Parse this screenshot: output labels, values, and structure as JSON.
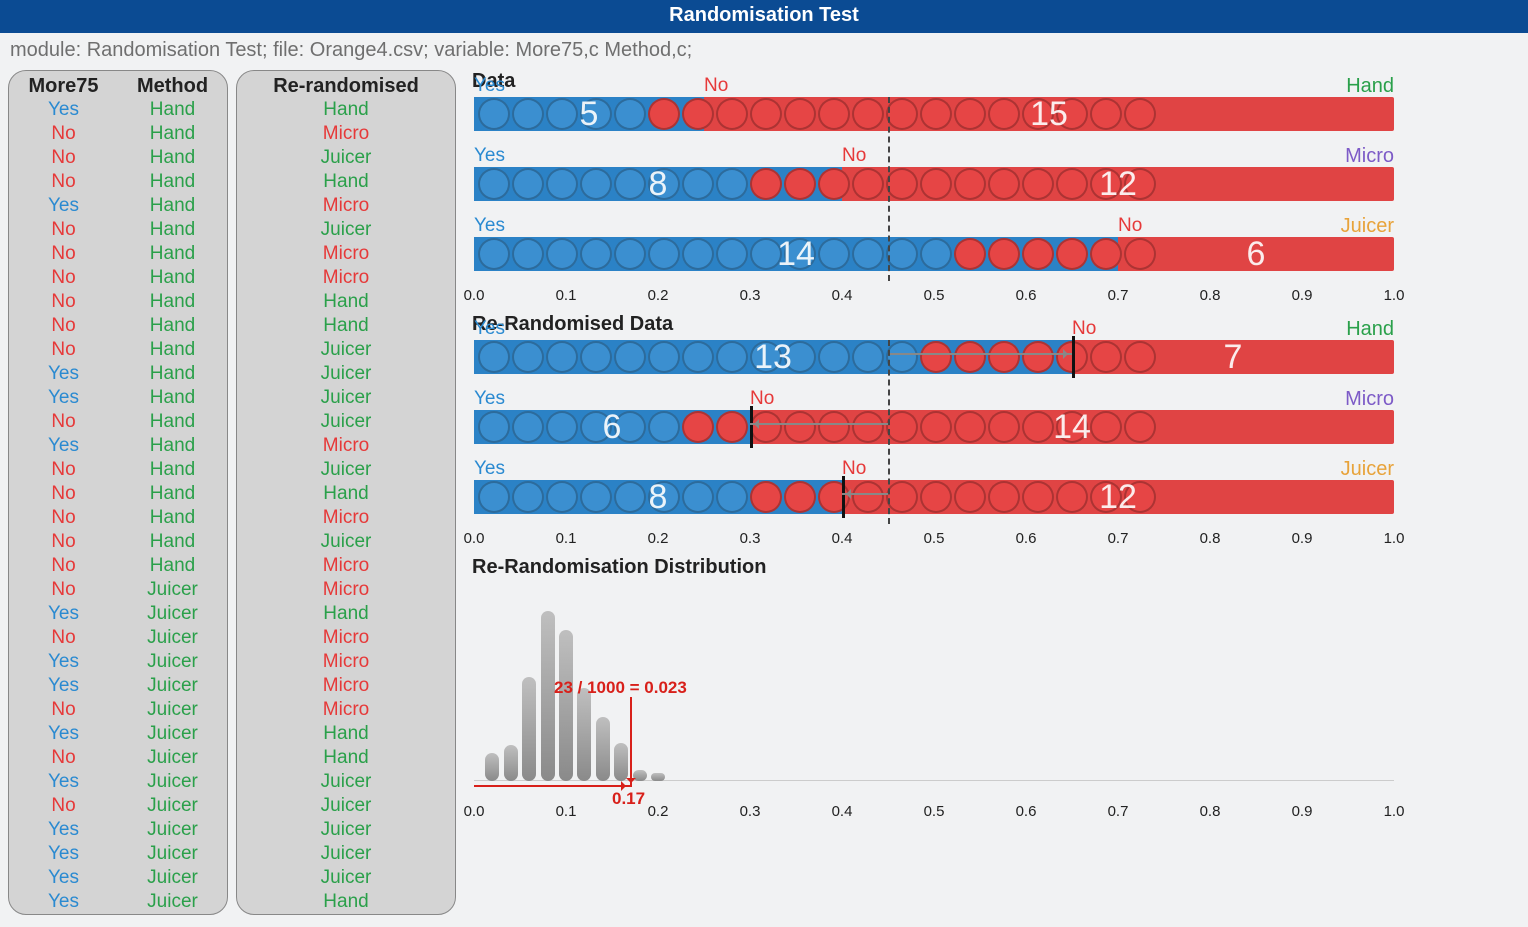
{
  "app": {
    "title": "Randomisation Test",
    "status": "module: Randomisation Test; file: Orange4.csv; variable: More75,c Method,c;"
  },
  "table": {
    "col1_header": "More75",
    "col2_header": "Method",
    "col3_header": "Re-randomised"
  },
  "rows": [
    {
      "m": "Yes",
      "g": "Hand",
      "r": "Hand"
    },
    {
      "m": "No",
      "g": "Hand",
      "r": "Micro"
    },
    {
      "m": "No",
      "g": "Hand",
      "r": "Juicer"
    },
    {
      "m": "No",
      "g": "Hand",
      "r": "Hand"
    },
    {
      "m": "Yes",
      "g": "Hand",
      "r": "Micro"
    },
    {
      "m": "No",
      "g": "Hand",
      "r": "Juicer"
    },
    {
      "m": "No",
      "g": "Hand",
      "r": "Micro"
    },
    {
      "m": "No",
      "g": "Hand",
      "r": "Micro"
    },
    {
      "m": "No",
      "g": "Hand",
      "r": "Hand"
    },
    {
      "m": "No",
      "g": "Hand",
      "r": "Hand"
    },
    {
      "m": "No",
      "g": "Hand",
      "r": "Juicer"
    },
    {
      "m": "Yes",
      "g": "Hand",
      "r": "Juicer"
    },
    {
      "m": "Yes",
      "g": "Hand",
      "r": "Juicer"
    },
    {
      "m": "No",
      "g": "Hand",
      "r": "Juicer"
    },
    {
      "m": "Yes",
      "g": "Hand",
      "r": "Micro"
    },
    {
      "m": "No",
      "g": "Hand",
      "r": "Juicer"
    },
    {
      "m": "No",
      "g": "Hand",
      "r": "Hand"
    },
    {
      "m": "No",
      "g": "Hand",
      "r": "Micro"
    },
    {
      "m": "No",
      "g": "Hand",
      "r": "Juicer"
    },
    {
      "m": "No",
      "g": "Hand",
      "r": "Micro"
    },
    {
      "m": "No",
      "g": "Juicer",
      "r": "Micro"
    },
    {
      "m": "Yes",
      "g": "Juicer",
      "r": "Hand"
    },
    {
      "m": "No",
      "g": "Juicer",
      "r": "Micro"
    },
    {
      "m": "Yes",
      "g": "Juicer",
      "r": "Micro"
    },
    {
      "m": "Yes",
      "g": "Juicer",
      "r": "Micro"
    },
    {
      "m": "No",
      "g": "Juicer",
      "r": "Micro"
    },
    {
      "m": "Yes",
      "g": "Juicer",
      "r": "Hand"
    },
    {
      "m": "No",
      "g": "Juicer",
      "r": "Hand"
    },
    {
      "m": "Yes",
      "g": "Juicer",
      "r": "Juicer"
    },
    {
      "m": "No",
      "g": "Juicer",
      "r": "Juicer"
    },
    {
      "m": "Yes",
      "g": "Juicer",
      "r": "Juicer"
    },
    {
      "m": "Yes",
      "g": "Juicer",
      "r": "Juicer"
    },
    {
      "m": "Yes",
      "g": "Juicer",
      "r": "Juicer"
    },
    {
      "m": "Yes",
      "g": "Juicer",
      "r": "Hand"
    }
  ],
  "labels": {
    "yes": "Yes",
    "no": "No",
    "data_title": "Data",
    "rerand_title": "Re-Randomised Data",
    "dist_title": "Re-Randomisation Distribution"
  },
  "chart_data": {
    "type": "bar",
    "axis_ticks": [
      "0.0",
      "0.1",
      "0.2",
      "0.3",
      "0.4",
      "0.5",
      "0.6",
      "0.7",
      "0.8",
      "0.9",
      "1.0"
    ],
    "reference_line": 0.45,
    "data_bars": [
      {
        "group": "Hand",
        "yes": 5,
        "no": 15,
        "color": "green"
      },
      {
        "group": "Micro",
        "yes": 8,
        "no": 12,
        "color": "purple"
      },
      {
        "group": "Juicer",
        "yes": 14,
        "no": 6,
        "color": "orange"
      }
    ],
    "rerand_bars": [
      {
        "group": "Hand",
        "yes": 13,
        "no": 7,
        "color": "green",
        "shift_from": 0.45,
        "shift_to": 0.65,
        "dir": "right"
      },
      {
        "group": "Micro",
        "yes": 6,
        "no": 14,
        "color": "purple",
        "shift_from": 0.45,
        "shift_to": 0.3,
        "dir": "left"
      },
      {
        "group": "Juicer",
        "yes": 8,
        "no": 12,
        "color": "orange",
        "shift_from": 0.45,
        "shift_to": 0.4,
        "dir": "left"
      }
    ],
    "distribution": {
      "x": [
        0.0,
        0.02,
        0.04,
        0.06,
        0.08,
        0.1,
        0.12,
        0.14,
        0.16,
        0.18,
        0.2
      ],
      "heights": [
        0,
        30,
        38,
        110,
        180,
        160,
        98,
        68,
        40,
        12,
        8
      ],
      "observed": 0.17,
      "tail_count": 23,
      "total": 1000,
      "p_value": 0.023,
      "tail_text": "23 / 1000 = 0.023",
      "observed_text": "0.17"
    }
  }
}
